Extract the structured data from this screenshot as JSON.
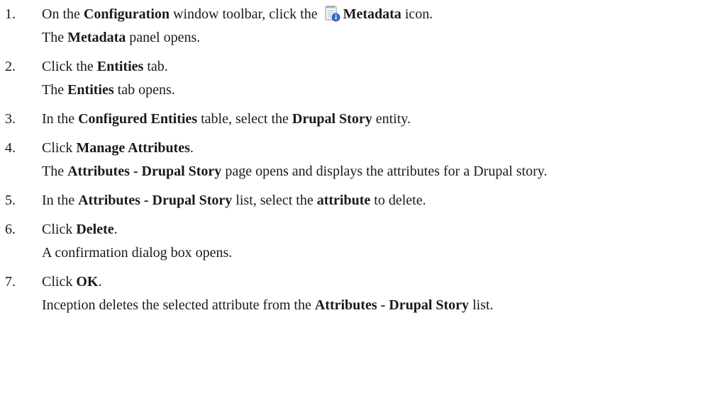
{
  "steps": [
    {
      "number": "1.",
      "text": {
        "p1": "On the ",
        "b1": "Configuration",
        "p2": " window toolbar, click the ",
        "icon": "metadata-notepad-info-icon",
        "b2": "Metadata",
        "p3": " icon."
      },
      "result": {
        "b1": "Metadata",
        "p1": " panel opens."
      }
    },
    {
      "number": "2.",
      "text": {
        "p1": "Click the ",
        "b1": "Entities",
        "p2": " tab."
      },
      "result": {
        "p0": "The ",
        "b1": "Entities",
        "p1": " tab opens."
      }
    },
    {
      "number": "3.",
      "text": {
        "p1": "In the ",
        "b1": "Configured Entities",
        "p2": " table, select the ",
        "b2": "Drupal Story",
        "p3": " entity."
      }
    },
    {
      "number": "4.",
      "text": {
        "p1": "Click ",
        "b1": "Manage Attributes",
        "p2": "."
      },
      "result": {
        "p0": "The ",
        "b1": "Attributes - Drupal Story",
        "p1": " page opens and displays the attributes for a Drupal story."
      }
    },
    {
      "number": "5.",
      "text": {
        "p1": "In the ",
        "b1": "Attributes - Drupal Story",
        "p2": " list, select the ",
        "b2": "attribute",
        "p3": " to delete."
      }
    },
    {
      "number": "6.",
      "text": {
        "p1": "Click ",
        "b1": "Delete",
        "p2": "."
      },
      "result": {
        "p1": "A confirmation dialog box opens."
      }
    },
    {
      "number": "7.",
      "text": {
        "p1": "Click ",
        "b1": "OK",
        "p2": "."
      },
      "result": {
        "p1": "Inception deletes the selected attribute from the ",
        "b1": "Attributes - Drupal Story",
        "p2": " list."
      }
    }
  ],
  "colors": {
    "text": "#1a1a1a",
    "icon_paper": "#ffffff",
    "icon_lines": "#9aa7b5",
    "icon_info": "#2f6fcf"
  }
}
